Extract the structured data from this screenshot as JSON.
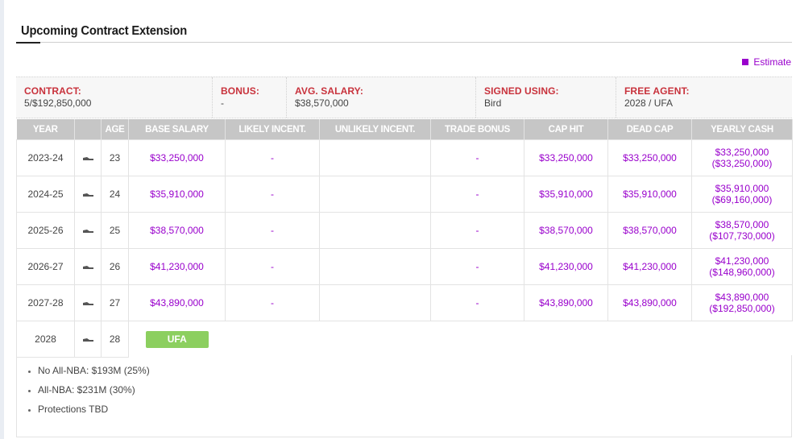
{
  "section": {
    "title": "Upcoming Contract Extension"
  },
  "legend": {
    "estimate_label": "Estimate",
    "estimate_color": "#9900cc"
  },
  "summary": [
    {
      "label": "CONTRACT:",
      "value": "5/$192,850,000"
    },
    {
      "label": "BONUS:",
      "value": "-"
    },
    {
      "label": "AVG. SALARY:",
      "value": "$38,570,000"
    },
    {
      "label": "SIGNED USING:",
      "value": "Bird"
    },
    {
      "label": "FREE AGENT:",
      "value": "2028 / UFA"
    }
  ],
  "table": {
    "headers": [
      "YEAR",
      "",
      "AGE",
      "BASE SALARY",
      "LIKELY INCENT.",
      "UNLIKELY INCENT.",
      "TRADE BONUS",
      "CAP HIT",
      "DEAD CAP",
      "YEARLY CASH"
    ],
    "rows": [
      {
        "year": "2023-24",
        "age": "23",
        "base": "$33,250,000",
        "likely": "-",
        "unlikely": "",
        "trade": "-",
        "cap": "$33,250,000",
        "dead": "$33,250,000",
        "cash": "$33,250,000",
        "cash_cum": "($33,250,000)"
      },
      {
        "year": "2024-25",
        "age": "24",
        "base": "$35,910,000",
        "likely": "-",
        "unlikely": "",
        "trade": "-",
        "cap": "$35,910,000",
        "dead": "$35,910,000",
        "cash": "$35,910,000",
        "cash_cum": "($69,160,000)"
      },
      {
        "year": "2025-26",
        "age": "25",
        "base": "$38,570,000",
        "likely": "-",
        "unlikely": "",
        "trade": "-",
        "cap": "$38,570,000",
        "dead": "$38,570,000",
        "cash": "$38,570,000",
        "cash_cum": "($107,730,000)"
      },
      {
        "year": "2026-27",
        "age": "26",
        "base": "$41,230,000",
        "likely": "-",
        "unlikely": "",
        "trade": "-",
        "cap": "$41,230,000",
        "dead": "$41,230,000",
        "cash": "$41,230,000",
        "cash_cum": "($148,960,000)"
      },
      {
        "year": "2027-28",
        "age": "27",
        "base": "$43,890,000",
        "likely": "-",
        "unlikely": "",
        "trade": "-",
        "cap": "$43,890,000",
        "dead": "$43,890,000",
        "cash": "$43,890,000",
        "cash_cum": "($192,850,000)"
      }
    ],
    "final_row": {
      "year": "2028",
      "age": "28",
      "badge": "UFA"
    }
  },
  "notes": [
    "No All-NBA: $193M (25%)",
    "All-NBA: $231M (30%)",
    "Protections TBD"
  ],
  "colors": {
    "accent_red": "#c8323c",
    "accent_purple": "#9900cc",
    "ufa_green": "#8ccf5f",
    "header_gray": "#c6c6c6"
  },
  "icons": {
    "row_icon": "sneaker-icon"
  }
}
